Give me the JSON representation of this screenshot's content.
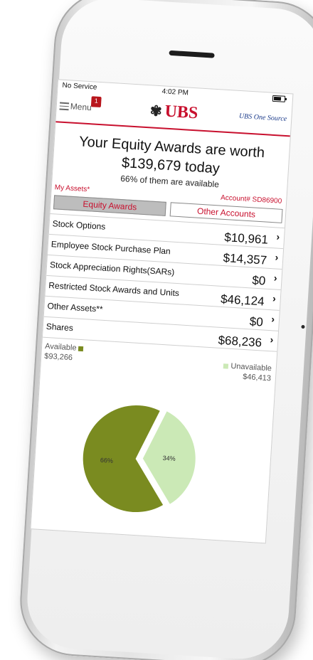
{
  "status_bar": {
    "carrier": "No Service",
    "time": "4:02 PM"
  },
  "header": {
    "menu_label": "Menu",
    "notification_count": "1",
    "brand": "UBS",
    "brand_symbol": "✾",
    "secondary_logo": "UBS One Source"
  },
  "summary": {
    "line1": "Your Equity Awards are worth",
    "line2": "$139,679 today",
    "line3": "66% of them are available"
  },
  "assets_label": "My Assets*",
  "account": "Account# SD86900",
  "tabs": [
    {
      "label": "Equity Awards",
      "active": true
    },
    {
      "label": "Other Accounts",
      "active": false
    }
  ],
  "rows": [
    {
      "label": "Stock Options",
      "value": "$10,961"
    },
    {
      "label": "Employee Stock Purchase Plan",
      "value": "$14,357"
    },
    {
      "label": "Stock Appreciation Rights(SARs)",
      "value": "$0"
    },
    {
      "label": "Restricted Stock Awards and Units",
      "value": "$46,124"
    },
    {
      "label": "Other Assets**",
      "value": "$0"
    },
    {
      "label": "Shares",
      "value": "$68,236"
    }
  ],
  "legend": {
    "available_label": "Available",
    "available_value": "$93,266",
    "unavailable_label": "Unavailable",
    "unavailable_value": "$46,413"
  },
  "chart_data": {
    "type": "pie",
    "categories": [
      "Available",
      "Unavailable"
    ],
    "values": [
      66,
      34
    ],
    "labels": [
      "66%",
      "34%"
    ],
    "colors": [
      "#7a8b20",
      "#cbe9b6"
    ]
  },
  "colors": {
    "brand_red": "#c8102e",
    "available": "#7a8b20",
    "unavailable": "#cbe9b6"
  }
}
